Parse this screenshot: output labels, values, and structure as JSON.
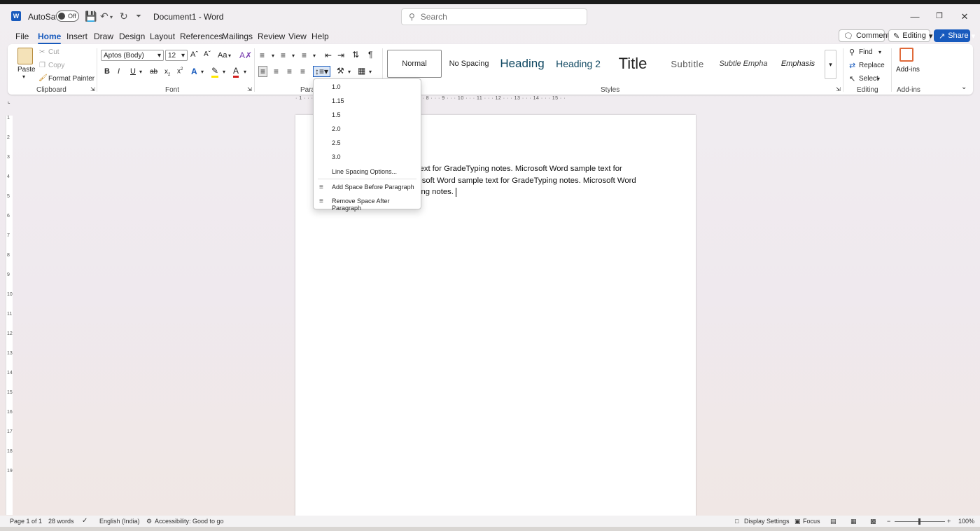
{
  "titlebar": {
    "autosave_label": "AutoSave",
    "autosave_state": "Off",
    "document_title": "Document1  -  Word",
    "search_placeholder": "Search"
  },
  "menu": {
    "tabs": [
      "File",
      "Home",
      "Insert",
      "Draw",
      "Design",
      "Layout",
      "References",
      "Mailings",
      "Review",
      "View",
      "Help"
    ],
    "active_tab": "Home",
    "comments": "Comments",
    "editing": "Editing",
    "share": "Share"
  },
  "ribbon": {
    "clipboard": {
      "paste": "Paste",
      "cut": "Cut",
      "copy": "Copy",
      "format_painter": "Format Painter",
      "label": "Clipboard"
    },
    "font": {
      "family": "Aptos (Body)",
      "size": "12",
      "case_btn": "Aa",
      "bold": "B",
      "italic": "I",
      "underline": "U",
      "strike": "ab",
      "subscript": "x",
      "superscript": "x",
      "text_effects": "A",
      "font_color": "A",
      "label": "Font"
    },
    "paragraph": {
      "label": "Para"
    },
    "styles": {
      "items": [
        "Normal",
        "No Spacing",
        "Heading",
        "Heading 2",
        "Title",
        "Subtitle",
        "Subtle Empha",
        "Emphasis"
      ],
      "label": "Styles"
    },
    "editing": {
      "find": "Find",
      "replace": "Replace",
      "select": "Select",
      "label": "Editing"
    },
    "addins": {
      "button": "Add-ins",
      "label": "Add-ins"
    }
  },
  "ruler": {
    "horizontal": "· 1 · · · 1 · · · 2 · · · 3 · · · 4 · · · 5 · · · 6 · · · 7 · · · 8 · · · 9 · · · 10 · · · 11 · · · 12 · · · 13 · · · 14 · · · 15 · ·",
    "vertical": [
      "1",
      "2",
      "3",
      "4",
      "5",
      "6",
      "7",
      "8",
      "9",
      "10",
      "11",
      "12",
      "13",
      "14",
      "15",
      "16",
      "17",
      "18",
      "19"
    ]
  },
  "document": {
    "lines": [
      "e text for GradeTyping notes. Microsoft Word sample text for",
      "crosoft Word sample text for GradeTyping notes. Microsoft Word",
      "yping notes."
    ]
  },
  "line_spacing_menu": {
    "options": [
      "1.0",
      "1.15",
      "1.5",
      "2.0",
      "2.5",
      "3.0"
    ],
    "more_options": "Line Spacing Options...",
    "add_space_before": "Add Space Before Paragraph",
    "remove_space_after": "Remove Space After Paragraph"
  },
  "statusbar": {
    "page": "Page 1 of 1",
    "words": "28 words",
    "language": "English (India)",
    "accessibility": "Accessibility: Good to go",
    "display_settings": "Display Settings",
    "focus": "Focus",
    "zoom": "100%"
  },
  "colors": {
    "accent": "#185abd",
    "ribbon_bg": "#ffffff",
    "window_bg": "#f0ecef"
  }
}
